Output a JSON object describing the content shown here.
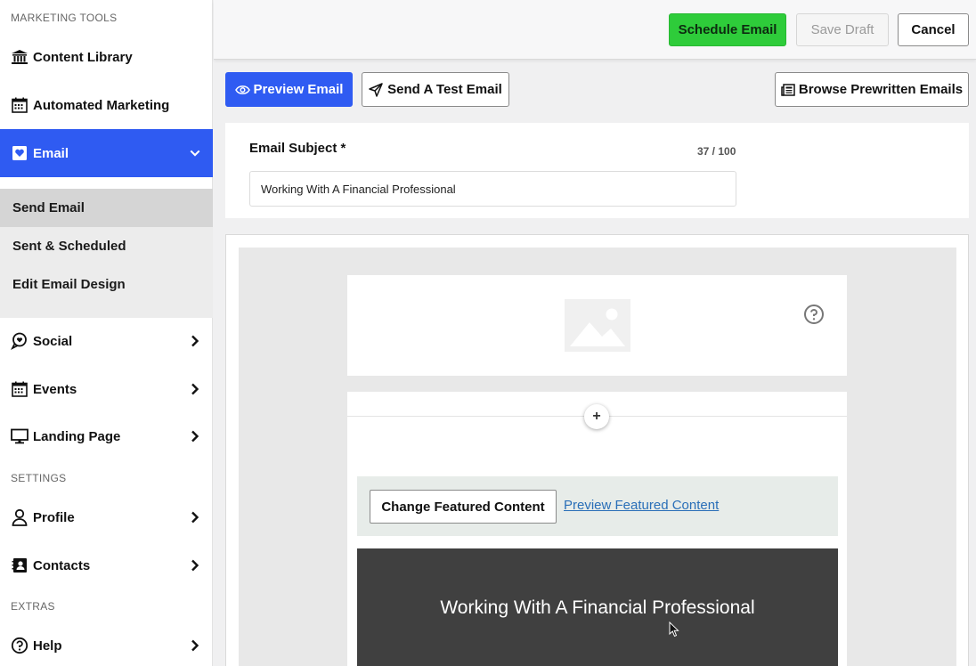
{
  "sidebar": {
    "section_marketing": "MARKETING TOOLS",
    "section_settings": "SETTINGS",
    "section_extras": "EXTRAS",
    "items": {
      "content_library": "Content Library",
      "automated_marketing": "Automated Marketing",
      "email": "Email",
      "social": "Social",
      "events": "Events",
      "landing_page": "Landing Page",
      "profile": "Profile",
      "contacts": "Contacts",
      "help": "Help"
    },
    "email_submenu": {
      "send_email": "Send Email",
      "sent_scheduled": "Sent & Scheduled",
      "edit_design": "Edit Email Design"
    }
  },
  "topbar": {
    "schedule": "Schedule Email",
    "save_draft": "Save Draft",
    "cancel": "Cancel"
  },
  "toolbar": {
    "preview": "Preview Email",
    "send_test": "Send A Test Email",
    "browse": "Browse Prewritten Emails"
  },
  "subject": {
    "label": "Email Subject *",
    "count": "37 / 100",
    "value": "Working With A Financial Professional"
  },
  "editor": {
    "add_symbol": "+",
    "change_featured": "Change Featured Content",
    "preview_featured": "Preview Featured Content",
    "hero_title": "Working With A Financial Professional"
  },
  "colors": {
    "accent_blue": "#2f5bf2",
    "schedule_green": "#2ecc3a",
    "hero_bg": "#404040",
    "link_blue": "#2a6fb8"
  }
}
